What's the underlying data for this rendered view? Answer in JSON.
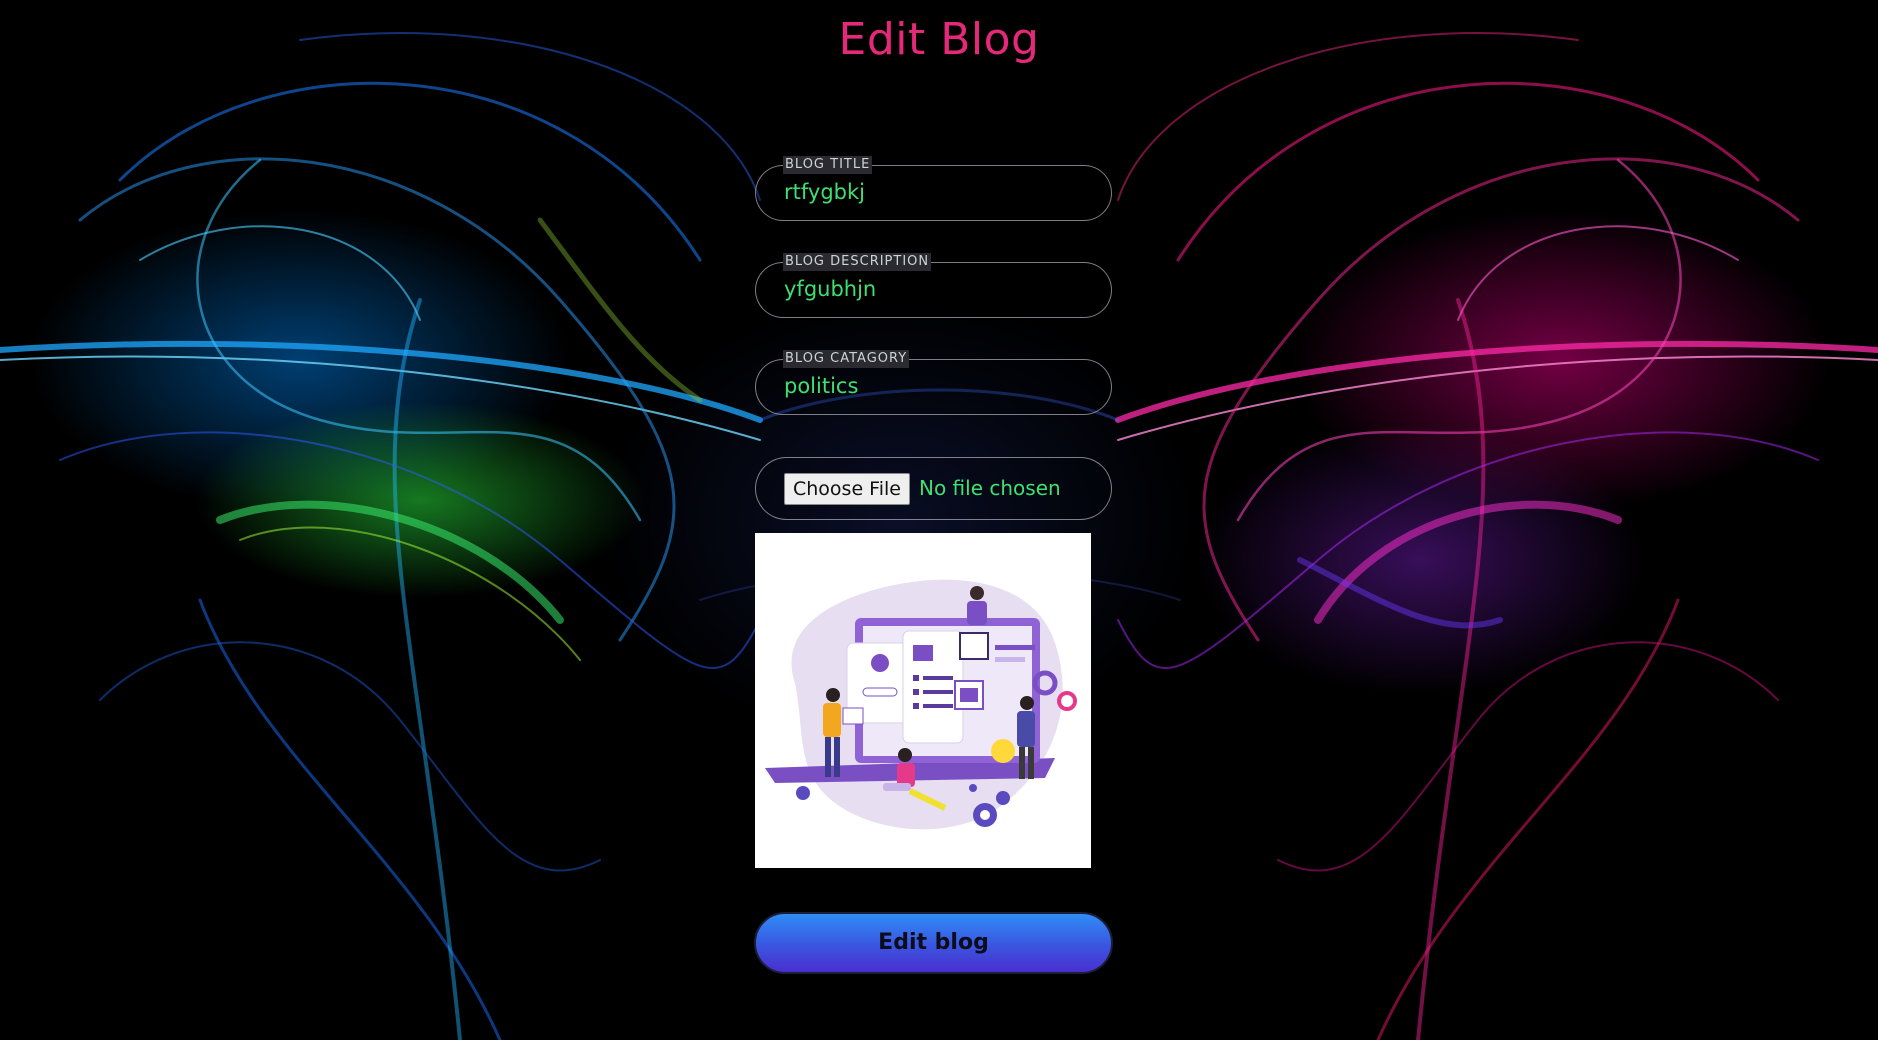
{
  "page": {
    "title": "Edit Blog"
  },
  "form": {
    "title_field": {
      "legend": "BLOG TITLE",
      "value": "rtfygbkj"
    },
    "description_field": {
      "legend": "BLOG DESCRIPTION",
      "value": "yfgubhjn"
    },
    "category_field": {
      "legend": "BLOG CATAGORY",
      "value": "politics"
    },
    "file_field": {
      "button_label": "Choose File",
      "status": "No file chosen"
    },
    "submit_label": "Edit blog"
  },
  "colors": {
    "title": "#e6287a",
    "field_text": "#3ee070",
    "button_gradient_top": "#2f8cf5",
    "button_gradient_bottom": "#4a2fcf"
  }
}
